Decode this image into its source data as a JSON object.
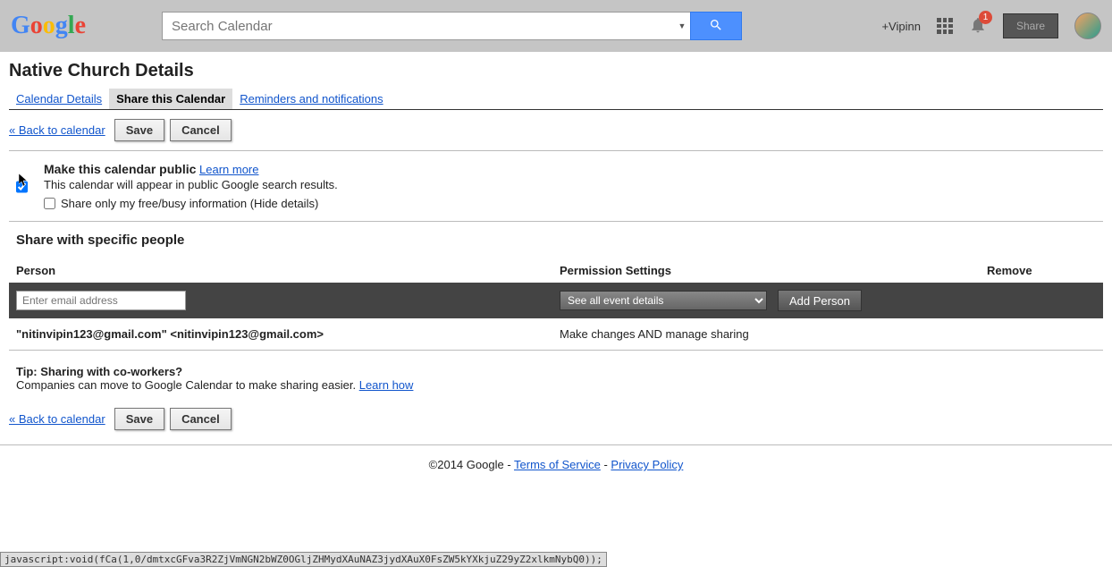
{
  "header": {
    "search_placeholder": "Search Calendar",
    "user": "+Vipinn",
    "notif_count": "1",
    "share_label": "Share"
  },
  "page_title": "Native Church Details",
  "tabs": {
    "details": "Calendar Details",
    "share": "Share this Calendar",
    "reminders": "Reminders and notifications"
  },
  "actions": {
    "back": "« Back to calendar",
    "save": "Save",
    "cancel": "Cancel"
  },
  "public_section": {
    "title": "Make this calendar public",
    "learn": "Learn more",
    "desc": "This calendar will appear in public Google search results.",
    "freebusy": "Share only my free/busy information (Hide details)"
  },
  "share_section": {
    "title": "Share with specific people",
    "col_person": "Person",
    "col_perm": "Permission Settings",
    "col_remove": "Remove",
    "email_placeholder": "Enter email address",
    "perm_option": "See all event details",
    "add_btn": "Add Person",
    "rows": [
      {
        "person": "\"nitinvipin123@gmail.com\" <nitinvipin123@gmail.com>",
        "perm": "Make changes AND manage sharing"
      }
    ]
  },
  "tip": {
    "title": "Tip: Sharing with co-workers?",
    "desc": "Companies can move to Google Calendar to make sharing easier. ",
    "learn": "Learn how"
  },
  "footer": {
    "copyright": "©2014 Google",
    "sep": " - ",
    "terms": "Terms of Service",
    "privacy": "Privacy Policy"
  },
  "status": "javascript:void(fCa(1,0/dmtxcGFva3R2ZjVmNGN2bWZ0OGljZHMydXAuNAZ3jydXAuX0FsZW5kYXkjuZ29yZ2xlkmNybQ0));"
}
